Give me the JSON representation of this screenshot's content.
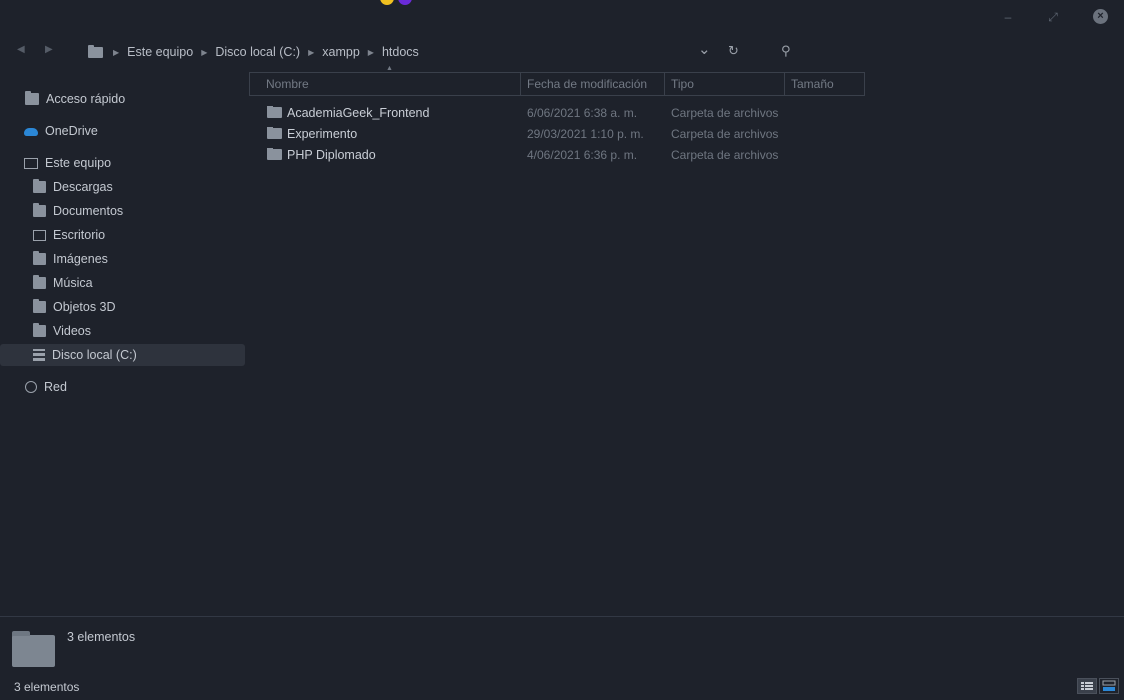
{
  "window": {
    "minimize_glyph": "–",
    "maximize_glyph": "⤢",
    "close_glyph": "×",
    "accent_colors": [
      "#f0c020",
      "#6a2bd8"
    ]
  },
  "nav": {
    "back_glyph": "◀",
    "forward_glyph": "▶",
    "breadcrumbs": [
      "Este equipo",
      "Disco local (C:)",
      "xampp",
      "htdocs"
    ],
    "dropdown_glyph": "⌄",
    "refresh_glyph": "↻",
    "search_glyph": "⚲"
  },
  "sidebar": {
    "items": [
      {
        "label": "Acceso rápido",
        "icon": "folder-icon"
      },
      {
        "label": "OneDrive",
        "icon": "cloud-icon"
      },
      {
        "label": "Este equipo",
        "icon": "computer-icon"
      },
      {
        "label": "Descargas",
        "icon": "downloads-icon"
      },
      {
        "label": "Documentos",
        "icon": "documents-icon"
      },
      {
        "label": "Escritorio",
        "icon": "desktop-icon"
      },
      {
        "label": "Imágenes",
        "icon": "pictures-icon"
      },
      {
        "label": "Música",
        "icon": "music-icon"
      },
      {
        "label": "Objetos 3D",
        "icon": "3d-objects-icon"
      },
      {
        "label": "Videos",
        "icon": "videos-icon"
      },
      {
        "label": "Disco local (C:)",
        "icon": "drive-icon",
        "selected": true
      },
      {
        "label": "Red",
        "icon": "network-icon"
      }
    ]
  },
  "list": {
    "columns": [
      "Nombre",
      "Fecha de modificación",
      "Tipo",
      "Tamaño"
    ],
    "sort_glyph": "▲",
    "rows": [
      {
        "name": "AcademiaGeek_Frontend",
        "date": "6/06/2021 6:38 a. m.",
        "type": "Carpeta de archivos",
        "size": ""
      },
      {
        "name": "Experimento",
        "date": "29/03/2021 1:10 p. m.",
        "type": "Carpeta de archivos",
        "size": ""
      },
      {
        "name": "PHP Diplomado",
        "date": "4/06/2021 6:36 p. m.",
        "type": "Carpeta de archivos",
        "size": ""
      }
    ]
  },
  "details": {
    "count_label": "3 elementos"
  },
  "status": {
    "count_label": "3 elementos"
  }
}
